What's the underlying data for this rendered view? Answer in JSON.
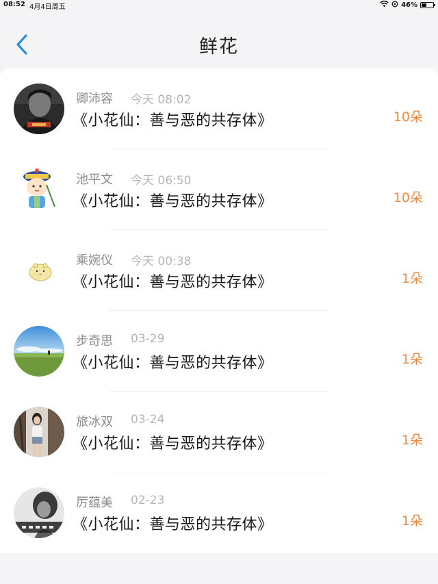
{
  "status_bar": {
    "time": "08:52",
    "date": "4月4日周五",
    "battery": "46%",
    "battery_level": 0.46
  },
  "header": {
    "title": "鲜花"
  },
  "colors": {
    "accent": "#2a8ee0",
    "count": "#f0883e",
    "name": "#8c8c8c",
    "time": "#b5b5b5"
  },
  "items": [
    {
      "name": "卿沛容",
      "time": "今天 08:02",
      "title": "《小花仙：善与恶的共存体》",
      "count": "10朵",
      "avatar": "dark-portrait"
    },
    {
      "name": "池平文",
      "time": "今天 06:50",
      "title": "《小花仙：善与恶的共存体》",
      "count": "10朵",
      "avatar": "cartoon-official"
    },
    {
      "name": "乘婉仪",
      "time": "今天 00:38",
      "title": "《小花仙：善与恶的共存体》",
      "count": "1朵",
      "avatar": "hamster"
    },
    {
      "name": "步奇思",
      "time": "03-29",
      "title": "《小花仙：善与恶的共存体》",
      "count": "1朵",
      "avatar": "landscape"
    },
    {
      "name": "旅冰双",
      "time": "03-24",
      "title": "《小花仙：善与恶的共存体》",
      "count": "1朵",
      "avatar": "girl-tree"
    },
    {
      "name": "厉蕴美",
      "time": "02-23",
      "title": "《小花仙：善与恶的共存体》",
      "count": "1朵",
      "avatar": "bw-girl"
    }
  ]
}
